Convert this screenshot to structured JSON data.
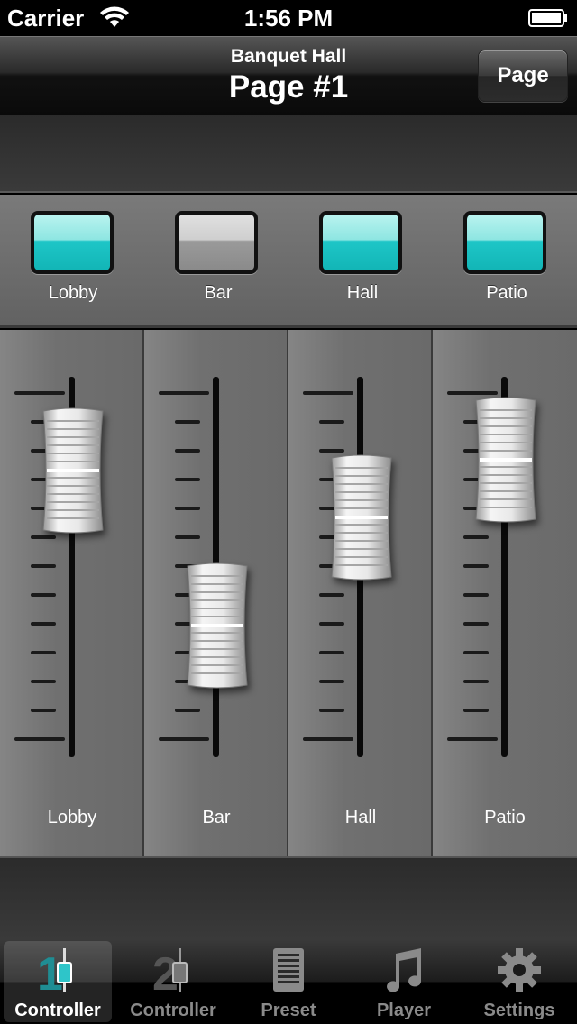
{
  "status_bar": {
    "carrier": "Carrier",
    "time": "1:56 PM"
  },
  "nav": {
    "subtitle": "Banquet Hall",
    "title": "Page #1",
    "page_button": "Page"
  },
  "toggles": [
    {
      "label": "Lobby",
      "on": true
    },
    {
      "label": "Bar",
      "on": false
    },
    {
      "label": "Hall",
      "on": true
    },
    {
      "label": "Patio",
      "on": true
    }
  ],
  "channels": [
    {
      "label": "Lobby",
      "level": 0.75
    },
    {
      "label": "Bar",
      "level": 0.32
    },
    {
      "label": "Hall",
      "level": 0.62
    },
    {
      "label": "Patio",
      "level": 0.78
    }
  ],
  "tabs": [
    {
      "label": "Controller",
      "icon": "controller-1-icon",
      "active": true
    },
    {
      "label": "Controller",
      "icon": "controller-2-icon",
      "active": false
    },
    {
      "label": "Preset",
      "icon": "preset-icon",
      "active": false
    },
    {
      "label": "Player",
      "icon": "music-note-icon",
      "active": false
    },
    {
      "label": "Settings",
      "icon": "gear-icon",
      "active": false
    }
  ],
  "colors": {
    "led_on": "#1ec6c7",
    "led_off": "#9a9a9a",
    "active_tab_accent": "#2ec5c9"
  }
}
